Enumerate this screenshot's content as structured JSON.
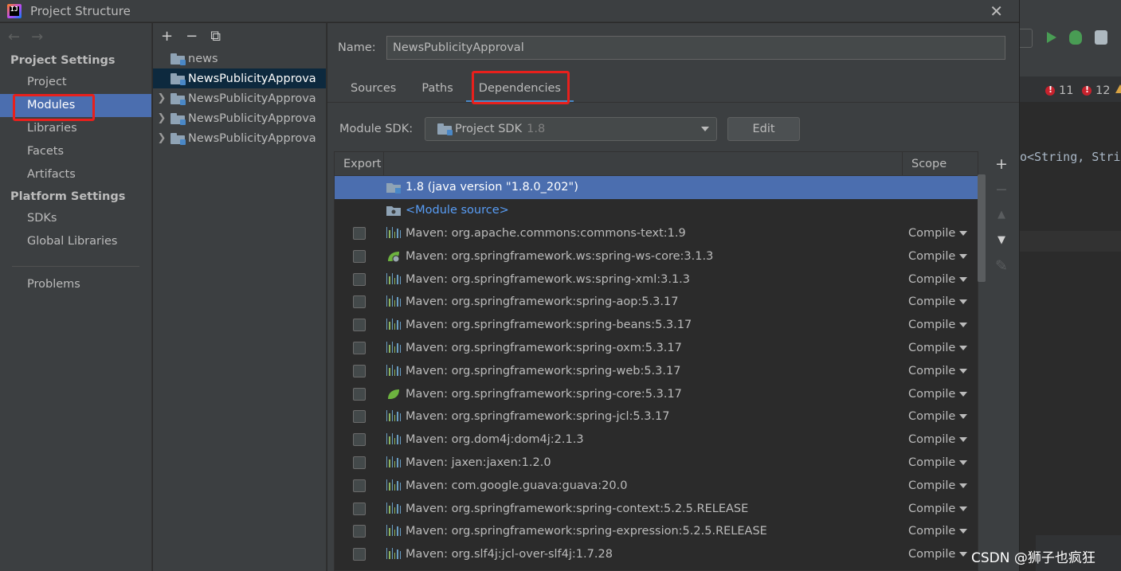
{
  "window": {
    "title": "Project Structure",
    "close_glyph": "✕"
  },
  "nav": {
    "back_glyph": "←",
    "forward_glyph": "→"
  },
  "sidebar": {
    "project_settings_header": "Project Settings",
    "project_items": [
      {
        "label": "Project"
      },
      {
        "label": "Modules",
        "selected": true
      },
      {
        "label": "Libraries"
      },
      {
        "label": "Facets"
      },
      {
        "label": "Artifacts"
      }
    ],
    "platform_settings_header": "Platform Settings",
    "platform_items": [
      {
        "label": "SDKs"
      },
      {
        "label": "Global Libraries"
      }
    ],
    "problems_label": "Problems"
  },
  "tree": {
    "toolbar": {
      "add": "+",
      "remove": "−",
      "copy": "⧉"
    },
    "rows": [
      {
        "label": "news",
        "expandable": false,
        "selected": false
      },
      {
        "label": "NewsPublicityApprova",
        "expandable": false,
        "selected": true
      },
      {
        "label": "NewsPublicityApprova",
        "expandable": true,
        "selected": false
      },
      {
        "label": "NewsPublicityApprova",
        "expandable": true,
        "selected": false
      },
      {
        "label": "NewsPublicityApprova",
        "expandable": true,
        "selected": false
      }
    ]
  },
  "module": {
    "name_label": "Name:",
    "name_value": "NewsPublicityApproval",
    "tabs": [
      {
        "label": "Sources"
      },
      {
        "label": "Paths"
      },
      {
        "label": "Dependencies",
        "active": true
      }
    ],
    "sdk_label": "Module SDK:",
    "sdk_value": "Project SDK",
    "sdk_version": "1.8",
    "edit_label": "Edit"
  },
  "dependencies": {
    "header_export": "Export",
    "header_scope": "Scope",
    "rows": [
      {
        "name": "1.8 (java version \"1.8.0_202\")",
        "icon": "jdk-folder-icon",
        "checkbox": false,
        "scope": "",
        "selected": true
      },
      {
        "name": "<Module source>",
        "icon": "module-source-icon",
        "checkbox": false,
        "scope": "",
        "link": true
      },
      {
        "name": "Maven: org.apache.commons:commons-text:1.9",
        "icon": "maven-library-icon",
        "checkbox": true,
        "scope": "Compile"
      },
      {
        "name": "Maven: org.springframework.ws:spring-ws-core:3.1.3",
        "icon": "spring-web-icon",
        "checkbox": true,
        "scope": "Compile"
      },
      {
        "name": "Maven: org.springframework.ws:spring-xml:3.1.3",
        "icon": "maven-library-icon",
        "checkbox": true,
        "scope": "Compile"
      },
      {
        "name": "Maven: org.springframework:spring-aop:5.3.17",
        "icon": "maven-library-icon",
        "checkbox": true,
        "scope": "Compile"
      },
      {
        "name": "Maven: org.springframework:spring-beans:5.3.17",
        "icon": "maven-library-icon",
        "checkbox": true,
        "scope": "Compile"
      },
      {
        "name": "Maven: org.springframework:spring-oxm:5.3.17",
        "icon": "maven-library-icon",
        "checkbox": true,
        "scope": "Compile"
      },
      {
        "name": "Maven: org.springframework:spring-web:5.3.17",
        "icon": "maven-library-icon",
        "checkbox": true,
        "scope": "Compile"
      },
      {
        "name": "Maven: org.springframework:spring-core:5.3.17",
        "icon": "spring-leaf-icon",
        "checkbox": true,
        "scope": "Compile"
      },
      {
        "name": "Maven: org.springframework:spring-jcl:5.3.17",
        "icon": "maven-library-icon",
        "checkbox": true,
        "scope": "Compile"
      },
      {
        "name": "Maven: org.dom4j:dom4j:2.1.3",
        "icon": "maven-library-icon",
        "checkbox": true,
        "scope": "Compile"
      },
      {
        "name": "Maven: jaxen:jaxen:1.2.0",
        "icon": "maven-library-icon",
        "checkbox": true,
        "scope": "Compile"
      },
      {
        "name": "Maven: com.google.guava:guava:20.0",
        "icon": "maven-library-icon",
        "checkbox": true,
        "scope": "Compile"
      },
      {
        "name": "Maven: org.springframework:spring-context:5.2.5.RELEASE",
        "icon": "maven-library-icon",
        "checkbox": true,
        "scope": "Compile"
      },
      {
        "name": "Maven: org.springframework:spring-expression:5.2.5.RELEASE",
        "icon": "maven-library-icon",
        "checkbox": true,
        "scope": "Compile"
      },
      {
        "name": "Maven: org.slf4j:jcl-over-slf4j:1.7.28",
        "icon": "maven-library-icon",
        "checkbox": true,
        "scope": "Compile"
      }
    ],
    "side_tools": {
      "add": "+",
      "remove": "−",
      "move_up": "▲",
      "move_down": "▼",
      "edit": "✎"
    }
  },
  "background_ide": {
    "error_count": "11",
    "second_count": "12",
    "code_line": "o<String, Stri",
    "code_keyword_comma": ","
  },
  "watermark": "CSDN @狮子也疯狂",
  "colors": {
    "selection": "#4b6eaf",
    "tab_underline": "#4a88c7",
    "highlight_box": "#e8201c",
    "link": "#589df6"
  }
}
